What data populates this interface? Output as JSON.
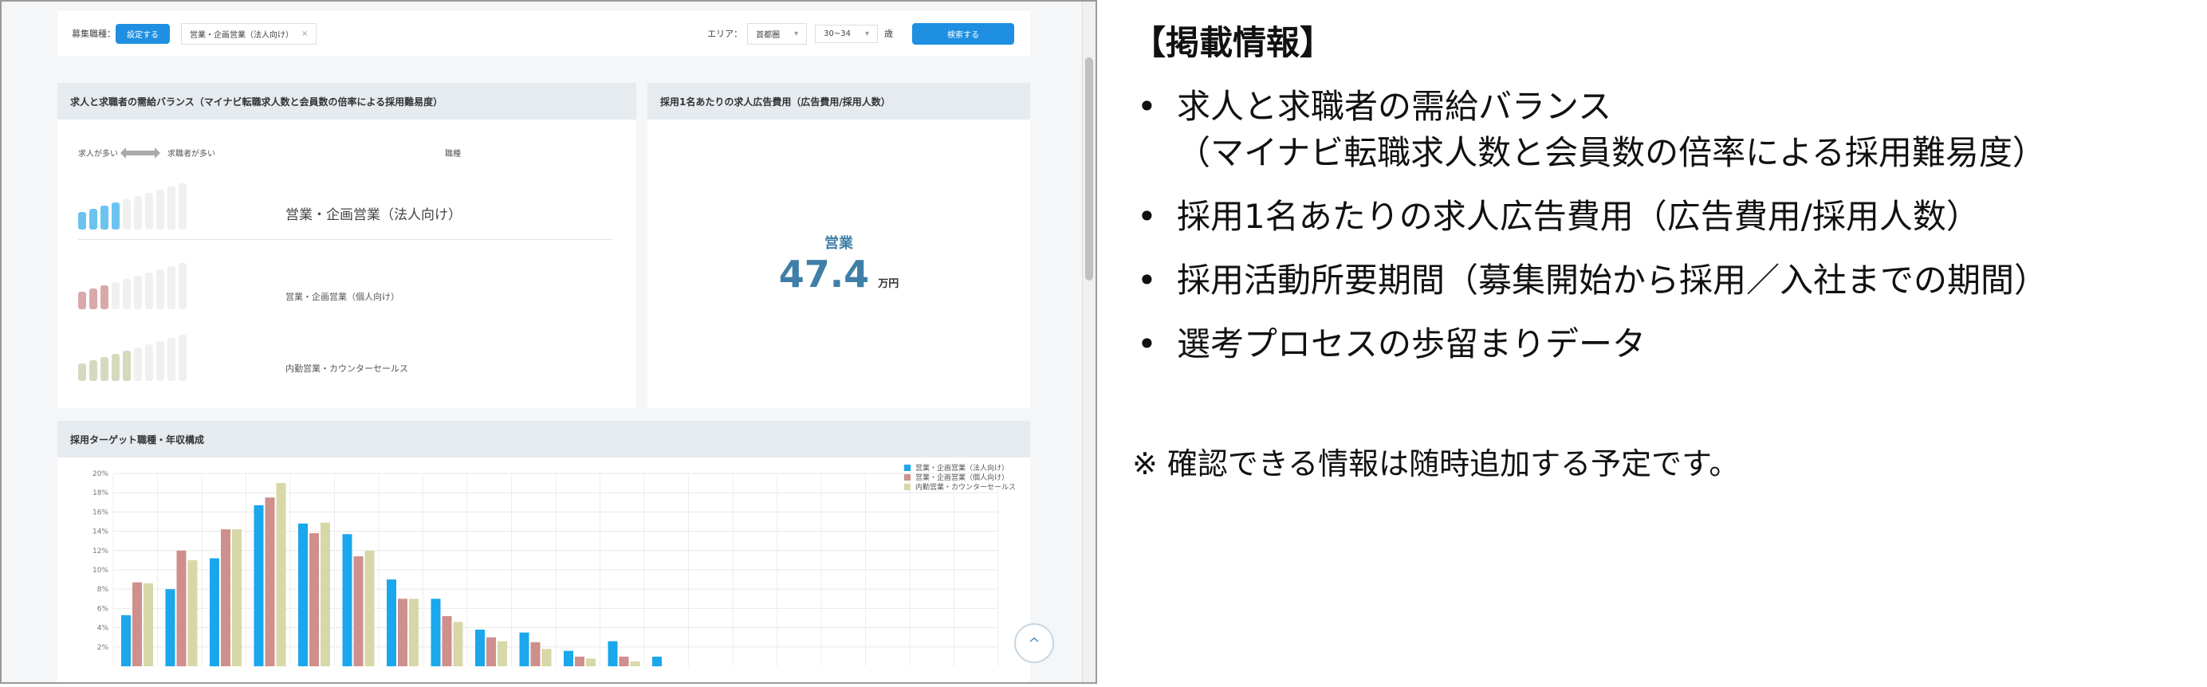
{
  "filter": {
    "recruit_label": "募集職種：",
    "set_button": "設定する",
    "job_tag": "営業・企画営業（法人向け）",
    "remove": "×",
    "area_label": "エリア：",
    "area_value": "首都圏",
    "age_value": "30~34",
    "age_suffix": "歳",
    "search_button": "検索する"
  },
  "balance": {
    "title": "求人と求職者の需給バランス（マイナビ転職求人数と会員数の倍率による採用難易度）",
    "left_label": "求人が多い",
    "right_label": "求職者が多い",
    "col_label": "職種",
    "rows": [
      {
        "label": "営業・企画営業（法人向け）",
        "level": 4,
        "color": "#6cc3f0"
      },
      {
        "label": "営業・企画営業（個人向け）",
        "level": 3,
        "color": "#d9a9aa"
      },
      {
        "label": "内勤営業・カウンターセールス",
        "level": 5,
        "color": "#d6d9bd"
      }
    ]
  },
  "cost": {
    "title": "採用1名あたりの求人広告費用（広告費用/採用人数）",
    "job": "営業",
    "value": "47.4",
    "unit": "万円"
  },
  "target": {
    "title": "採用ターゲット職種・年収構成"
  },
  "chart_data": {
    "type": "bar",
    "ylim": [
      0,
      20
    ],
    "yticks": [
      "20%",
      "18%",
      "16%",
      "14%",
      "12%",
      "10%",
      "8%",
      "6%",
      "4%",
      "2%"
    ],
    "series": [
      {
        "name": "営業・企画営業（法人向け）",
        "color": "#1aa7ec",
        "values": [
          5.3,
          8,
          11.2,
          16.7,
          14.8,
          13.7,
          9,
          7,
          3.8,
          3.5,
          1.6,
          2.6,
          1,
          0
        ]
      },
      {
        "name": "営業・企画営業（個人向け）",
        "color": "#cf8f8c",
        "values": [
          8.7,
          12,
          14.2,
          17.5,
          13.8,
          11.4,
          7,
          5.2,
          3,
          2.5,
          1,
          1,
          0,
          0
        ]
      },
      {
        "name": "内勤営業・カウンターセールス",
        "color": "#d8d7a8",
        "values": [
          8.6,
          11,
          14.2,
          19,
          14.9,
          12,
          7,
          4.6,
          2.6,
          1.8,
          0.8,
          0.5,
          0,
          0
        ]
      }
    ]
  },
  "scroll_top": "^",
  "info": {
    "title": "【掲載情報】",
    "items": [
      "求人と求職者の需給バランス",
      "（マイナビ転職求人数と会員数の倍率による採用難易度）",
      "採用1名あたりの求人広告費用（広告費用/採用人数）",
      "採用活動所要期間（募集開始から採用／入社までの期間）",
      "選考プロセスの歩留まりデータ"
    ],
    "note": "※ 確認できる情報は随時追加する予定です。"
  }
}
